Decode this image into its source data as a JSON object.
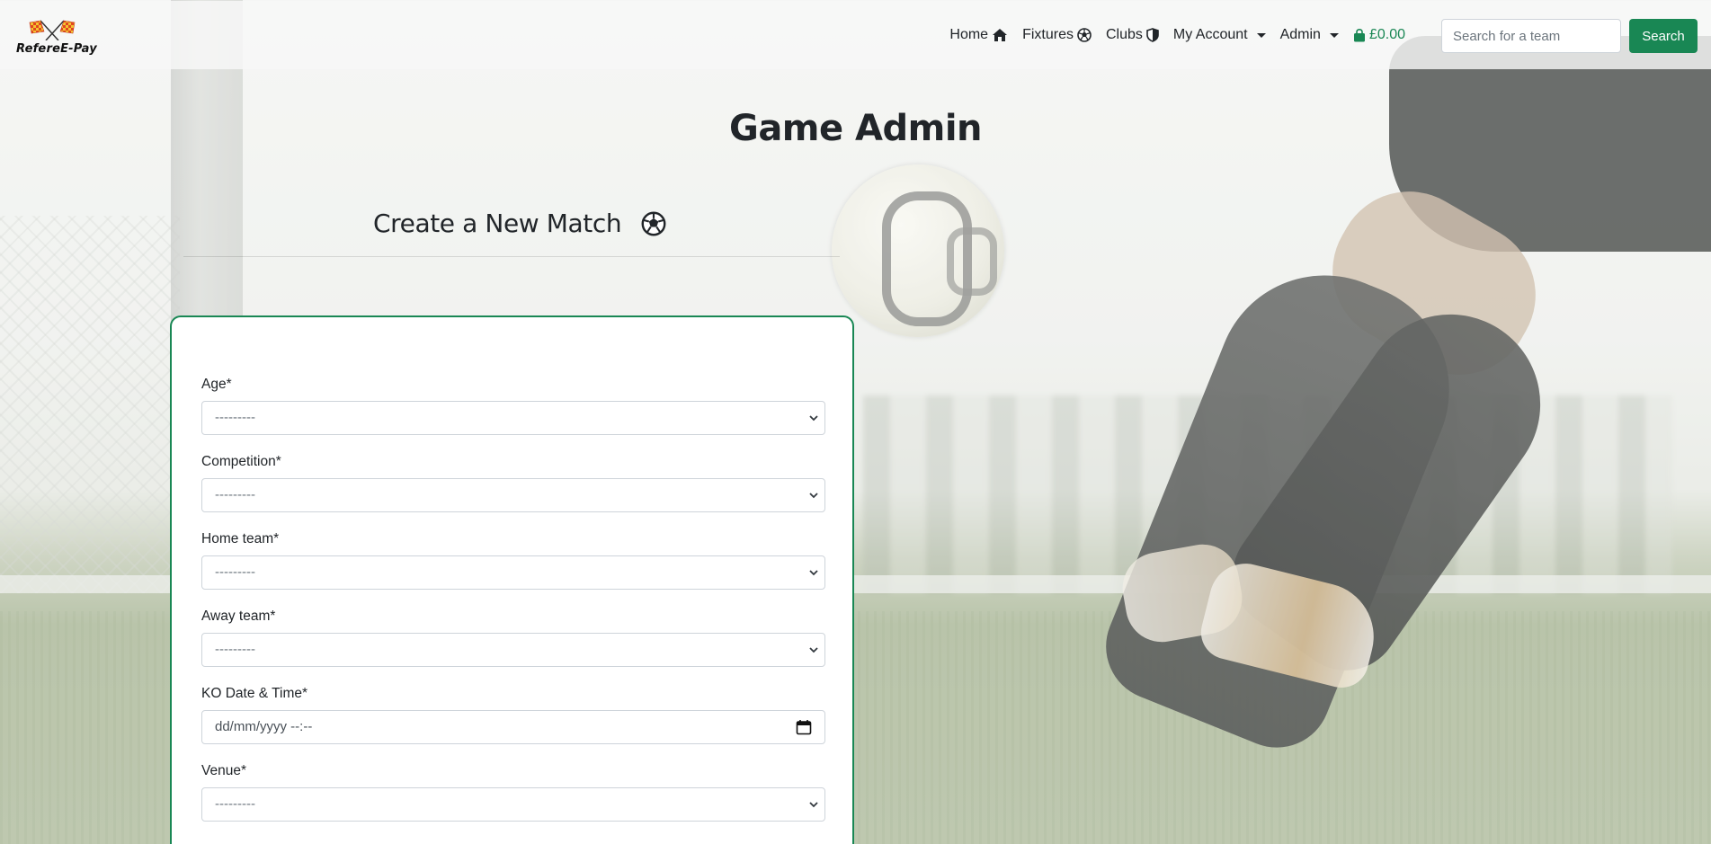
{
  "brand": {
    "name": "RefereE-Pay"
  },
  "nav": {
    "home": "Home",
    "fixtures": "Fixtures",
    "clubs": "Clubs",
    "my_account": "My Account",
    "admin": "Admin",
    "cart_total": "£0.00"
  },
  "search": {
    "placeholder": "Search for a team",
    "button": "Search"
  },
  "page": {
    "title": "Game Admin",
    "section_title": "Create a New Match"
  },
  "form": {
    "fields": [
      {
        "label": "Age*",
        "value": "---------"
      },
      {
        "label": "Competition*",
        "value": "---------"
      },
      {
        "label": "Home team*",
        "value": "---------"
      },
      {
        "label": "Away team*",
        "value": "---------"
      },
      {
        "label": "KO Date & Time*",
        "value": "dd/mm/yyyy --:--"
      },
      {
        "label": "Venue*",
        "value": "---------"
      }
    ]
  },
  "colors": {
    "accent": "#198754",
    "text": "#212529"
  },
  "icons": [
    "home-icon",
    "soccer-ball-icon",
    "shield-icon",
    "caret-down-icon",
    "shopping-bag-icon",
    "calendar-icon",
    "chevron-down-icon"
  ]
}
